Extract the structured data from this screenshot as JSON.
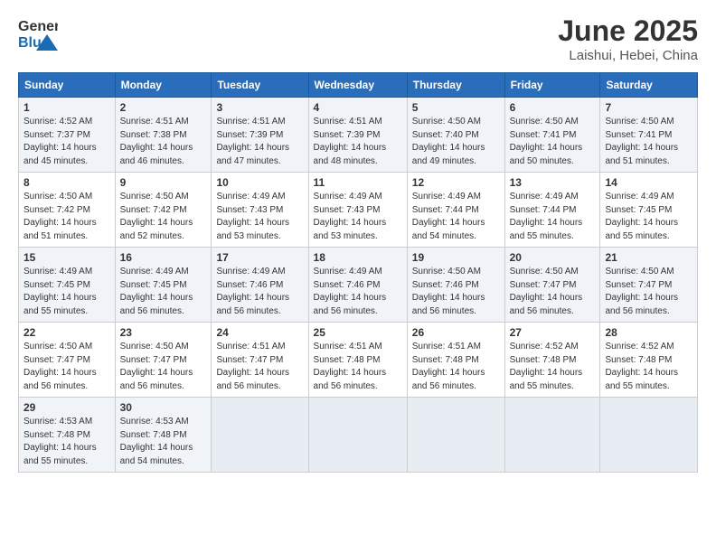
{
  "header": {
    "logo_general": "General",
    "logo_blue": "Blue",
    "title": "June 2025",
    "location": "Laishui, Hebei, China"
  },
  "days_of_week": [
    "Sunday",
    "Monday",
    "Tuesday",
    "Wednesday",
    "Thursday",
    "Friday",
    "Saturday"
  ],
  "weeks": [
    [
      {
        "day": "1",
        "sunrise": "4:52 AM",
        "sunset": "7:37 PM",
        "daylight": "14 hours and 45 minutes."
      },
      {
        "day": "2",
        "sunrise": "4:51 AM",
        "sunset": "7:38 PM",
        "daylight": "14 hours and 46 minutes."
      },
      {
        "day": "3",
        "sunrise": "4:51 AM",
        "sunset": "7:39 PM",
        "daylight": "14 hours and 47 minutes."
      },
      {
        "day": "4",
        "sunrise": "4:51 AM",
        "sunset": "7:39 PM",
        "daylight": "14 hours and 48 minutes."
      },
      {
        "day": "5",
        "sunrise": "4:50 AM",
        "sunset": "7:40 PM",
        "daylight": "14 hours and 49 minutes."
      },
      {
        "day": "6",
        "sunrise": "4:50 AM",
        "sunset": "7:41 PM",
        "daylight": "14 hours and 50 minutes."
      },
      {
        "day": "7",
        "sunrise": "4:50 AM",
        "sunset": "7:41 PM",
        "daylight": "14 hours and 51 minutes."
      }
    ],
    [
      {
        "day": "8",
        "sunrise": "4:50 AM",
        "sunset": "7:42 PM",
        "daylight": "14 hours and 51 minutes."
      },
      {
        "day": "9",
        "sunrise": "4:50 AM",
        "sunset": "7:42 PM",
        "daylight": "14 hours and 52 minutes."
      },
      {
        "day": "10",
        "sunrise": "4:49 AM",
        "sunset": "7:43 PM",
        "daylight": "14 hours and 53 minutes."
      },
      {
        "day": "11",
        "sunrise": "4:49 AM",
        "sunset": "7:43 PM",
        "daylight": "14 hours and 53 minutes."
      },
      {
        "day": "12",
        "sunrise": "4:49 AM",
        "sunset": "7:44 PM",
        "daylight": "14 hours and 54 minutes."
      },
      {
        "day": "13",
        "sunrise": "4:49 AM",
        "sunset": "7:44 PM",
        "daylight": "14 hours and 55 minutes."
      },
      {
        "day": "14",
        "sunrise": "4:49 AM",
        "sunset": "7:45 PM",
        "daylight": "14 hours and 55 minutes."
      }
    ],
    [
      {
        "day": "15",
        "sunrise": "4:49 AM",
        "sunset": "7:45 PM",
        "daylight": "14 hours and 55 minutes."
      },
      {
        "day": "16",
        "sunrise": "4:49 AM",
        "sunset": "7:45 PM",
        "daylight": "14 hours and 56 minutes."
      },
      {
        "day": "17",
        "sunrise": "4:49 AM",
        "sunset": "7:46 PM",
        "daylight": "14 hours and 56 minutes."
      },
      {
        "day": "18",
        "sunrise": "4:49 AM",
        "sunset": "7:46 PM",
        "daylight": "14 hours and 56 minutes."
      },
      {
        "day": "19",
        "sunrise": "4:50 AM",
        "sunset": "7:46 PM",
        "daylight": "14 hours and 56 minutes."
      },
      {
        "day": "20",
        "sunrise": "4:50 AM",
        "sunset": "7:47 PM",
        "daylight": "14 hours and 56 minutes."
      },
      {
        "day": "21",
        "sunrise": "4:50 AM",
        "sunset": "7:47 PM",
        "daylight": "14 hours and 56 minutes."
      }
    ],
    [
      {
        "day": "22",
        "sunrise": "4:50 AM",
        "sunset": "7:47 PM",
        "daylight": "14 hours and 56 minutes."
      },
      {
        "day": "23",
        "sunrise": "4:50 AM",
        "sunset": "7:47 PM",
        "daylight": "14 hours and 56 minutes."
      },
      {
        "day": "24",
        "sunrise": "4:51 AM",
        "sunset": "7:47 PM",
        "daylight": "14 hours and 56 minutes."
      },
      {
        "day": "25",
        "sunrise": "4:51 AM",
        "sunset": "7:48 PM",
        "daylight": "14 hours and 56 minutes."
      },
      {
        "day": "26",
        "sunrise": "4:51 AM",
        "sunset": "7:48 PM",
        "daylight": "14 hours and 56 minutes."
      },
      {
        "day": "27",
        "sunrise": "4:52 AM",
        "sunset": "7:48 PM",
        "daylight": "14 hours and 55 minutes."
      },
      {
        "day": "28",
        "sunrise": "4:52 AM",
        "sunset": "7:48 PM",
        "daylight": "14 hours and 55 minutes."
      }
    ],
    [
      {
        "day": "29",
        "sunrise": "4:53 AM",
        "sunset": "7:48 PM",
        "daylight": "14 hours and 55 minutes."
      },
      {
        "day": "30",
        "sunrise": "4:53 AM",
        "sunset": "7:48 PM",
        "daylight": "14 hours and 54 minutes."
      },
      null,
      null,
      null,
      null,
      null
    ]
  ]
}
